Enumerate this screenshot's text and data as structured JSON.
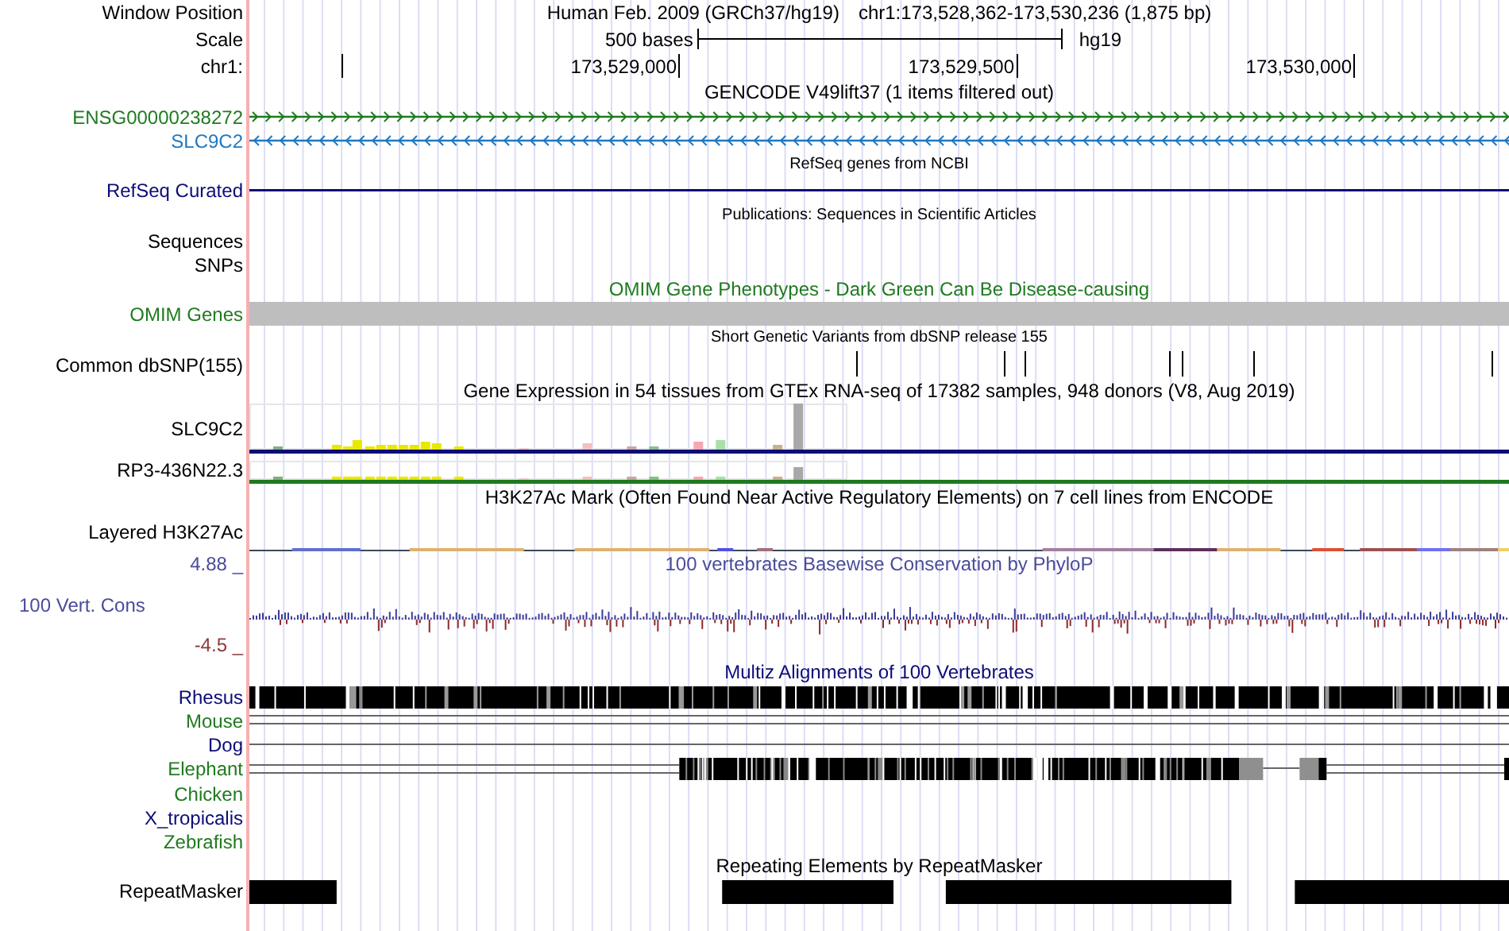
{
  "rows": [
    {
      "kind": "position",
      "label": "Window Position",
      "assembly": "Human Feb. 2009 (GRCh37/hg19)",
      "position": "chr1:173,528,362-173,530,236 (1,875 bp)"
    },
    {
      "kind": "scale",
      "label": "Scale",
      "text": "500 bases",
      "assembly": "hg19"
    },
    {
      "kind": "ruler",
      "label": "chr1:",
      "ticks": [
        "173,529,000",
        "173,529,500",
        "173,530,000"
      ]
    },
    {
      "kind": "title",
      "text": "GENCODE V49lift37 (1 items filtered out)",
      "color": "#000000"
    },
    {
      "kind": "gene",
      "label": "ENSG00000238272",
      "color": "#1f7a1f",
      "forward": true
    },
    {
      "kind": "gene",
      "label": "SLC9C2",
      "color": "#1f78c0",
      "forward": false
    },
    {
      "kind": "subtitle",
      "text": "RefSeq genes from NCBI"
    },
    {
      "kind": "line",
      "label": "RefSeq Curated",
      "color": "#0c0c78"
    },
    {
      "kind": "subtitle",
      "text": "Publications: Sequences in Scientific Articles"
    },
    {
      "kind": "label",
      "label": "Sequences",
      "color": "#000000"
    },
    {
      "kind": "label",
      "label": "SNPs",
      "color": "#000000"
    },
    {
      "kind": "title",
      "text": "OMIM Gene Phenotypes - Dark Green Can Be Disease-causing",
      "color": "#1f7a1f"
    },
    {
      "kind": "bar",
      "label": "OMIM Genes",
      "color": "#1f7a1f"
    },
    {
      "kind": "subtitle",
      "text": "Short Genetic Variants from dbSNP release 155"
    },
    {
      "kind": "snps",
      "label": "Common dbSNP(155)",
      "color": "#000000"
    },
    {
      "kind": "title",
      "text": "Gene Expression in 54 tissues from GTEx RNA-seq of 17382 samples, 948 donors (V8, Aug 2019)",
      "color": "#000000"
    },
    {
      "kind": "expression",
      "label": "SLC9C2",
      "color": "#0c0c78"
    },
    {
      "kind": "expression",
      "label": "RP3-436N22.3",
      "color": "#1f7a1f"
    },
    {
      "kind": "title",
      "text": "H3K27Ac Mark (Often Found Near Active Regulatory Elements) on 7 cell lines from ENCODE",
      "color": "#000000"
    },
    {
      "kind": "layered",
      "label": "Layered H3K27Ac",
      "color": "#000000"
    },
    {
      "kind": "conservation",
      "label": "100 Vert. Cons",
      "max": "4.88 _",
      "min": "-4.5 _",
      "title": "100 vertebrates Basewise Conservation by PhyloP",
      "color": "#4b4b9b"
    },
    {
      "kind": "title",
      "text": "Multiz Alignments of 100 Vertebrates",
      "color": "#0c0c78"
    },
    {
      "kind": "blocks",
      "label": "Rhesus",
      "color": "#0c0c78"
    },
    {
      "kind": "double",
      "label": "Mouse",
      "color": "#1f7a1f"
    },
    {
      "kind": "single",
      "label": "Dog",
      "color": "#0c0c78"
    },
    {
      "kind": "gapped",
      "label": "Elephant",
      "color": "#1f7a1f"
    },
    {
      "kind": "species",
      "label": "Chicken",
      "color": "#1f7a1f"
    },
    {
      "kind": "species",
      "label": "X_tropicalis",
      "color": "#0c0c78"
    },
    {
      "kind": "species",
      "label": "Zebrafish",
      "color": "#1f7a1f"
    },
    {
      "kind": "title",
      "text": "Repeating Elements by RepeatMasker",
      "color": "#000000"
    },
    {
      "kind": "repeats",
      "label": "RepeatMasker",
      "color": "#000000"
    }
  ]
}
